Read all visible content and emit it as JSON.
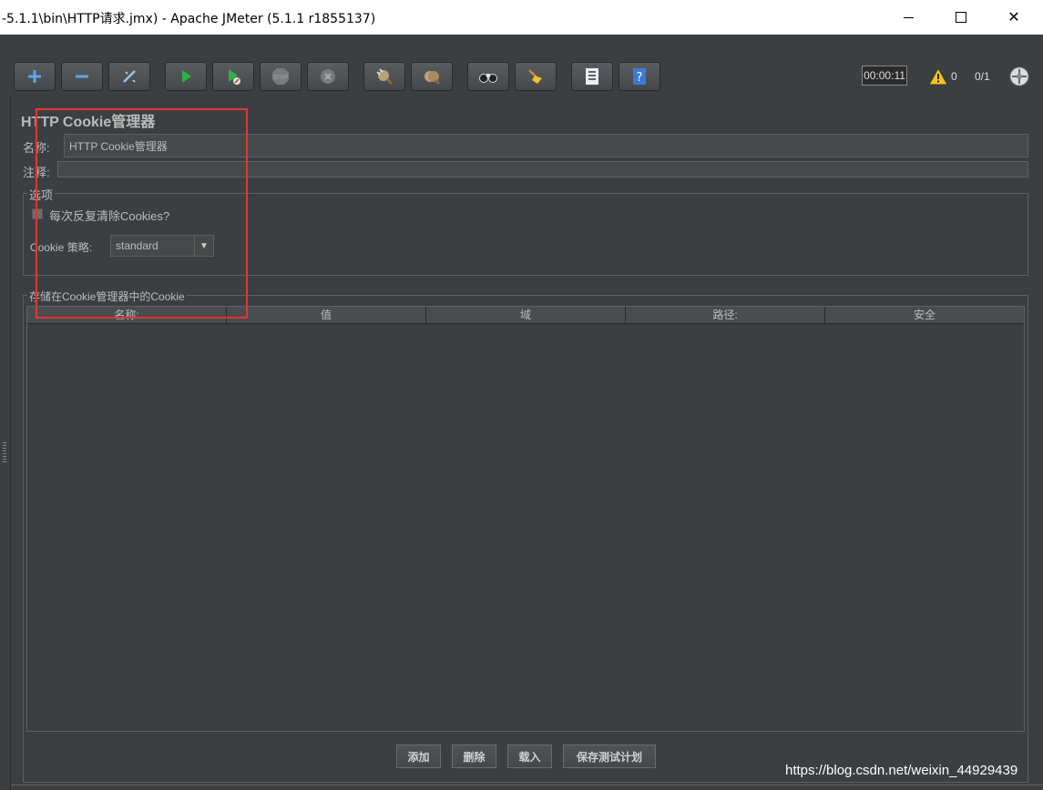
{
  "window": {
    "title": "-5.1.1\\bin\\HTTP请求.jmx) - Apache JMeter (5.1.1 r1855137)"
  },
  "toolbar": {
    "buttons": [
      {
        "name": "add-button",
        "icon": "plus-icon"
      },
      {
        "name": "remove-button",
        "icon": "minus-icon"
      },
      {
        "name": "toggle-button",
        "icon": "wand-icon"
      },
      {
        "name": "start-button",
        "icon": "play-icon"
      },
      {
        "name": "start-no-pause-button",
        "icon": "play-no-pause-icon"
      },
      {
        "name": "stop-button",
        "icon": "stop-icon"
      },
      {
        "name": "shutdown-button",
        "icon": "shutdown-icon"
      },
      {
        "name": "clear-button",
        "icon": "clear-icon"
      },
      {
        "name": "clear-all-button",
        "icon": "clear-all-icon"
      },
      {
        "name": "search-button",
        "icon": "binoculars-icon"
      },
      {
        "name": "reset-search-button",
        "icon": "broom-icon"
      },
      {
        "name": "function-helper-button",
        "icon": "list-icon"
      },
      {
        "name": "help-button",
        "icon": "help-icon"
      }
    ],
    "timer": "00:00:11",
    "warning_count": "0",
    "thread_ratio": "0/1"
  },
  "panel": {
    "title": "HTTP Cookie管理器",
    "name_label": "名称:",
    "name_value": "HTTP Cookie管理器",
    "comment_label": "注释:",
    "comment_value": "",
    "options_legend": "选项",
    "clear_each_iteration_label": "每次反复清除Cookies?",
    "clear_each_iteration_checked": false,
    "policy_label": "Cookie 策略:",
    "policy_value": "standard",
    "stored_legend": "存储在Cookie管理器中的Cookie",
    "columns": [
      "名称:",
      "值",
      "域",
      "路径:",
      "安全"
    ],
    "buttons": {
      "add": "添加",
      "delete": "删除",
      "load": "载入",
      "save": "保存测试计划"
    }
  },
  "watermark": "https://blog.csdn.net/weixin_44929439",
  "colors": {
    "background": "#3c3f41",
    "highlight_box": "#e83232"
  }
}
